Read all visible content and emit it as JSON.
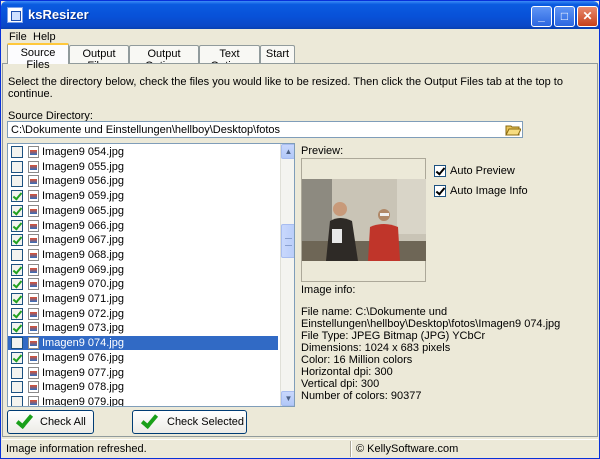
{
  "window": {
    "title": "ksResizer"
  },
  "menu": [
    "File",
    "Help"
  ],
  "tabs": [
    "Source Files",
    "Output Files",
    "Output Options",
    "Text Options",
    "Start"
  ],
  "instructions": "Select the directory below, check the files you would like to be resized. Then click the Output Files tab at the top to continue.",
  "source": {
    "label": "Source Directory:",
    "path": "C:\\Dokumente und Einstellungen\\hellboy\\Desktop\\fotos"
  },
  "files": [
    {
      "name": "Imagen9 054.jpg",
      "checked": false
    },
    {
      "name": "Imagen9 055.jpg",
      "checked": false
    },
    {
      "name": "Imagen9 056.jpg",
      "checked": false
    },
    {
      "name": "Imagen9 059.jpg",
      "checked": true
    },
    {
      "name": "Imagen9 065.jpg",
      "checked": true
    },
    {
      "name": "Imagen9 066.jpg",
      "checked": true
    },
    {
      "name": "Imagen9 067.jpg",
      "checked": true
    },
    {
      "name": "Imagen9 068.jpg",
      "checked": false
    },
    {
      "name": "Imagen9 069.jpg",
      "checked": true
    },
    {
      "name": "Imagen9 070.jpg",
      "checked": true
    },
    {
      "name": "Imagen9 071.jpg",
      "checked": true
    },
    {
      "name": "Imagen9 072.jpg",
      "checked": true
    },
    {
      "name": "Imagen9 073.jpg",
      "checked": true
    },
    {
      "name": "Imagen9 074.jpg",
      "checked": false,
      "selected": true
    },
    {
      "name": "Imagen9 076.jpg",
      "checked": true
    },
    {
      "name": "Imagen9 077.jpg",
      "checked": false
    },
    {
      "name": "Imagen9 078.jpg",
      "checked": false
    },
    {
      "name": "Imagen9 079.jpg",
      "checked": false
    }
  ],
  "buttons": {
    "check_all": "Check All",
    "check_selected": "Check Selected"
  },
  "preview": {
    "label": "Preview:",
    "image_info_label": "Image info:"
  },
  "options": {
    "auto_preview": "Auto Preview",
    "auto_preview_checked": true,
    "auto_image_info": "Auto Image Info",
    "auto_image_info_checked": true
  },
  "image_info": [
    "File name: C:\\Dokumente und",
    "Einstellungen\\hellboy\\Desktop\\fotos\\Imagen9 074.jpg",
    "File Type: JPEG Bitmap (JPG) YCbCr",
    "Dimensions: 1024 x 683 pixels",
    "Color: 16 Million colors",
    "Horizontal dpi: 300",
    "Vertical dpi: 300",
    "Number of colors: 90377"
  ],
  "status": {
    "left": "Image information refreshed.",
    "right": "© KellySoftware.com"
  },
  "icons": {
    "folder": "open-folder-icon",
    "check": "green-check-icon",
    "file": "jpg-file-icon"
  },
  "colors": {
    "title_bar": "#0a5be0",
    "selection": "#316ac5",
    "window_bg": "#ece9d8"
  }
}
